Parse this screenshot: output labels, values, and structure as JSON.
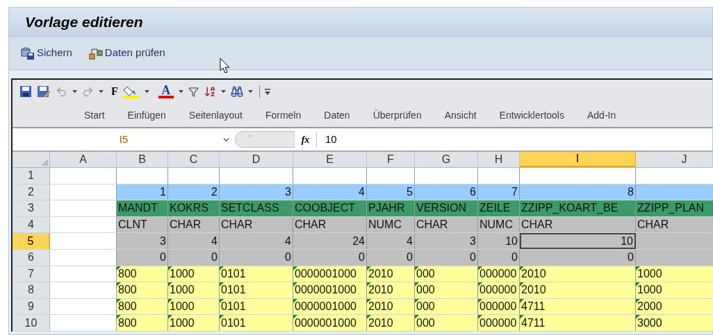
{
  "window": {
    "title": "Vorlage editieren"
  },
  "toolbar": [
    {
      "label": "Sichern"
    },
    {
      "label": "Daten prüfen"
    }
  ],
  "quick_access": {
    "bold_glyph": "F",
    "font_color_glyph": "A"
  },
  "ribbon_tabs": [
    {
      "label": "Start",
      "selected": false
    },
    {
      "label": "Einfügen",
      "selected": false
    },
    {
      "label": "Seitenlayout",
      "selected": false
    },
    {
      "label": "Formeln",
      "selected": false
    },
    {
      "label": "Daten",
      "selected": false
    },
    {
      "label": "Überprüfen",
      "selected": false
    },
    {
      "label": "Ansicht",
      "selected": false
    },
    {
      "label": "Entwicklertools",
      "selected": false
    },
    {
      "label": "Add-In",
      "selected": false
    }
  ],
  "formula_bar": {
    "name_box": "I5",
    "fx": "fx",
    "value": "10"
  },
  "columns": [
    {
      "label": "A",
      "selected": false
    },
    {
      "label": "B",
      "selected": false
    },
    {
      "label": "C",
      "selected": false
    },
    {
      "label": "D",
      "selected": false
    },
    {
      "label": "E",
      "selected": false
    },
    {
      "label": "F",
      "selected": false
    },
    {
      "label": "G",
      "selected": false
    },
    {
      "label": "H",
      "selected": false
    },
    {
      "label": "I",
      "selected": true
    },
    {
      "label": "J",
      "selected": false
    }
  ],
  "rows": [
    {
      "number": "1",
      "selected": false,
      "kind": "empty",
      "cells": [
        "",
        "",
        "",
        "",
        "",
        "",
        "",
        "",
        "",
        ""
      ]
    },
    {
      "number": "2",
      "selected": false,
      "kind": "index",
      "cells": [
        "",
        "1",
        "2",
        "3",
        "4",
        "5",
        "6",
        "7",
        "8",
        ""
      ]
    },
    {
      "number": "3",
      "selected": false,
      "kind": "name",
      "cells": [
        "",
        "MANDT",
        "KOKRS",
        "SETCLASS",
        "COOBJECT",
        "PJAHR",
        "VERSION",
        "ZEILE",
        "ZZIPP_KOART_BE",
        "ZZIPP_PLAN"
      ]
    },
    {
      "number": "4",
      "selected": false,
      "kind": "type",
      "cells": [
        "",
        "CLNT",
        "CHAR",
        "CHAR",
        "CHAR",
        "NUMC",
        "CHAR",
        "NUMC",
        "CHAR",
        "CHAR"
      ]
    },
    {
      "number": "5",
      "selected": true,
      "kind": "length",
      "cells": [
        "",
        "3",
        "4",
        "4",
        "24",
        "4",
        "3",
        "10",
        "10",
        ""
      ]
    },
    {
      "number": "6",
      "selected": false,
      "kind": "decimals",
      "cells": [
        "",
        "0",
        "0",
        "0",
        "0",
        "0",
        "0",
        "0",
        "0",
        ""
      ]
    },
    {
      "number": "7",
      "selected": false,
      "kind": "data",
      "cells": [
        "",
        "800",
        "1000",
        "0101",
        "0000001000",
        "2010",
        "000",
        "000000",
        "2010",
        "1000"
      ]
    },
    {
      "number": "8",
      "selected": false,
      "kind": "data",
      "cells": [
        "",
        "800",
        "1000",
        "0101",
        "0000001000",
        "2010",
        "000",
        "000000",
        "2010",
        "1000"
      ]
    },
    {
      "number": "9",
      "selected": false,
      "kind": "data",
      "cells": [
        "",
        "800",
        "1000",
        "0101",
        "0000001000",
        "2010",
        "000",
        "000000",
        "4711",
        "2000"
      ]
    },
    {
      "number": "10",
      "selected": false,
      "kind": "data",
      "cells": [
        "",
        "800",
        "1000",
        "0101",
        "0000001000",
        "2010",
        "000",
        "000000",
        "4711",
        "3000"
      ]
    }
  ]
}
